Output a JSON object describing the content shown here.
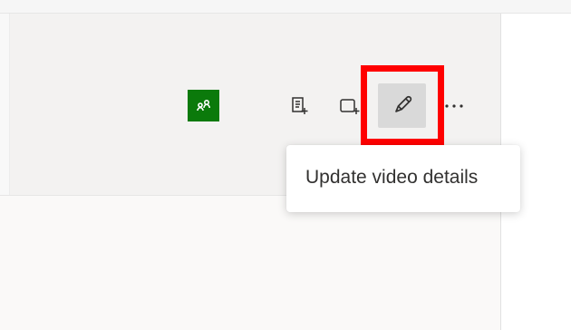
{
  "toolbar": {
    "people_icon": "people-icon",
    "add_list_icon": "add-list-icon",
    "add_screen_icon": "add-screen-icon",
    "edit_icon": "pencil-icon",
    "more_icon": "more-icon",
    "accent_green": "#0b7a0b",
    "highlight_red": "#ff0000"
  },
  "tooltip": {
    "text": "Update video details"
  }
}
